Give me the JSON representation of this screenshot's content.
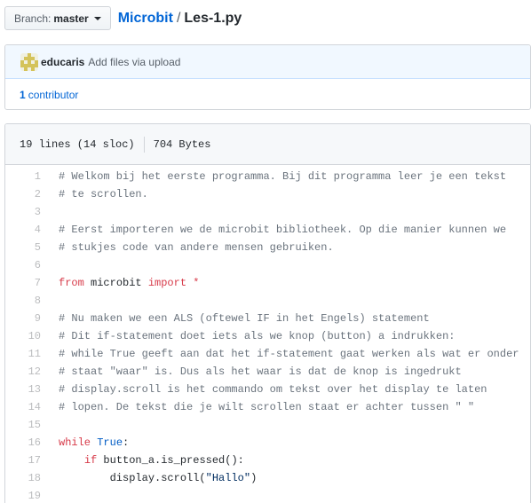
{
  "branch": {
    "label": "Branch:",
    "name": "master"
  },
  "breadcrumb": {
    "repo": "Microbit",
    "separator": "/",
    "file": "Les-1.py"
  },
  "commit": {
    "author": "educaris",
    "message": "Add files via upload"
  },
  "contributors": {
    "count": "1",
    "label": "contributor"
  },
  "file_info": {
    "lines": "19 lines (14 sloc)",
    "size": "704 Bytes"
  },
  "code": {
    "line_numbers": [
      "1",
      "2",
      "3",
      "4",
      "5",
      "6",
      "7",
      "8",
      "9",
      "10",
      "11",
      "12",
      "13",
      "14",
      "15",
      "16",
      "17",
      "18",
      "19"
    ],
    "lines": [
      "# Welkom bij het eerste programma. Bij dit programma leer je een tekst",
      "# te scrollen.",
      "",
      "# Eerst importeren we de microbit bibliotheek. Op die manier kunnen we",
      "# stukjes code van andere mensen gebruiken.",
      "",
      "from microbit import *",
      "",
      "# Nu maken we een ALS (oftewel IF in het Engels) statement",
      "# Dit if-statement doet iets als we knop (button) a indrukken:",
      "# while True geeft aan dat het if-statement gaat werken als wat er onder",
      "# staat \"waar\" is. Dus als het waar is dat de knop is ingedrukt",
      "# display.scroll is het commando om tekst over het display te laten",
      "# lopen. De tekst die je wilt scrollen staat er achter tussen \" \"",
      "",
      "while True:",
      "    if button_a.is_pressed():",
      "        display.scroll(\"Hallo\")",
      ""
    ]
  },
  "colors": {
    "link": "#0366d6",
    "keyword": "#d73a49",
    "comment": "#6a737d",
    "constant": "#005cc5",
    "string": "#032f62"
  },
  "icons": {
    "avatar": "avatar-identicon",
    "caret": "caret-down-icon"
  }
}
